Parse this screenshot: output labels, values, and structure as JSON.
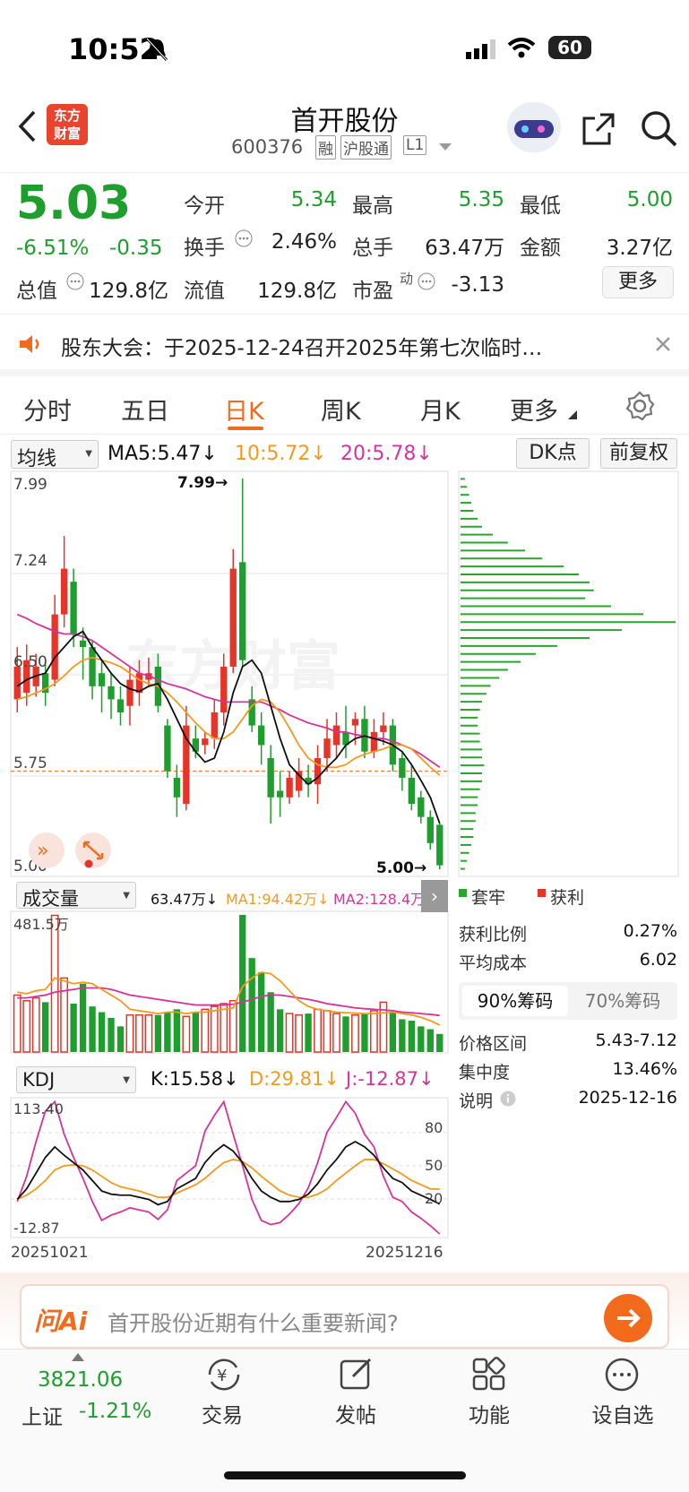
{
  "status_bar": {
    "time": "10:52",
    "battery": "60"
  },
  "header": {
    "title": "首开股份",
    "code": "600376",
    "tags": [
      "融",
      "沪股通",
      "L1"
    ],
    "logo_line1": "东方",
    "logo_line2": "财富"
  },
  "quote": {
    "price": "5.03",
    "change_pct": "-6.51%",
    "change": "-0.35",
    "open_label": "今开",
    "open": "5.34",
    "high_label": "最高",
    "high": "5.35",
    "low_label": "最低",
    "low": "5.00",
    "turnover_label": "换手",
    "turnover": "2.46%",
    "volume_label": "总手",
    "volume": "63.47万",
    "amount_label": "金额",
    "amount": "3.27亿",
    "mcap_label": "总值",
    "mcap": "129.8亿",
    "float_label": "流值",
    "float": "129.8亿",
    "pe_label": "市盈",
    "pe_sup": "动",
    "pe": "-3.13",
    "more_label": "更多"
  },
  "notice": {
    "text": "股东大会：于2025-12-24召开2025年第七次临时…"
  },
  "tabs": [
    "分时",
    "五日",
    "日K",
    "周K",
    "月K",
    "更多"
  ],
  "active_tab": "日K",
  "ma_bar": {
    "selector": "均线",
    "ma5": "MA5:5.47↓",
    "ma10": "10:5.72↓",
    "ma20": "20:5.78↓",
    "dk": "DK点",
    "fq": "前复权"
  },
  "price_axis": {
    "p1": "7.99",
    "p2": "7.24",
    "p3": "6.50",
    "p4": "5.75",
    "p5": "5.00",
    "hi_mark": "7.99→",
    "lo_mark": "5.00→"
  },
  "watermark": "东方财富",
  "vol_bar": {
    "selector": "成交量",
    "v": "63.47万↓",
    "ma1": "MA1:94.42万↓",
    "ma2": "MA2:128.4万",
    "max": "481.5万"
  },
  "kdj_bar": {
    "selector": "KDJ",
    "k": "K:15.58↓",
    "d": "D:29.81↓",
    "j": "J:-12.87↓",
    "max": "113.40",
    "min": "-12.87",
    "l80": "80",
    "l50": "50",
    "l20": "20"
  },
  "dates": {
    "start": "20251021",
    "end": "20251216"
  },
  "chips": {
    "legend_hold": "套牢",
    "legend_profit": "获利",
    "profit_ratio_label": "获利比例",
    "profit_ratio": "0.27%",
    "avg_cost_label": "平均成本",
    "avg_cost": "6.02",
    "tab90": "90%筹码",
    "tab70": "70%筹码",
    "range_label": "价格区间",
    "range": "5.43-7.12",
    "conc_label": "集中度",
    "conc": "13.46%",
    "note_label": "说明",
    "note": "2025-12-16"
  },
  "ai": {
    "logo": "问Ai",
    "placeholder": "首开股份近期有什么重要新闻?"
  },
  "bottom_nav": {
    "index_value": "3821.06",
    "index_name": "上证",
    "index_change": "-1.21%",
    "items": [
      "交易",
      "发帖",
      "功能",
      "设自选"
    ]
  },
  "colors": {
    "up": "#e5352b",
    "down": "#1e9e2c",
    "accent": "#f26a1b",
    "ma10": "#f39a1e",
    "ma20": "#d6339c"
  },
  "chart_data": {
    "type": "candlestick",
    "price_ylim": [
      5.0,
      7.99
    ],
    "candles": [
      {
        "o": 6.3,
        "c": 6.55,
        "h": 6.7,
        "l": 6.2,
        "up": true
      },
      {
        "o": 6.35,
        "c": 6.6,
        "h": 6.72,
        "l": 6.25,
        "up": true
      },
      {
        "o": 6.4,
        "c": 6.55,
        "h": 6.65,
        "l": 6.32,
        "up": true
      },
      {
        "o": 6.5,
        "c": 6.35,
        "h": 6.6,
        "l": 6.25,
        "up": false
      },
      {
        "o": 6.45,
        "c": 6.95,
        "h": 7.1,
        "l": 6.4,
        "up": true
      },
      {
        "o": 6.95,
        "c": 7.3,
        "h": 7.55,
        "l": 6.85,
        "up": true
      },
      {
        "o": 7.2,
        "c": 6.8,
        "h": 7.3,
        "l": 6.7,
        "up": false
      },
      {
        "o": 6.75,
        "c": 6.7,
        "h": 6.85,
        "l": 6.45,
        "up": false
      },
      {
        "o": 6.7,
        "c": 6.4,
        "h": 6.75,
        "l": 6.3,
        "up": false
      },
      {
        "o": 6.5,
        "c": 6.4,
        "h": 6.6,
        "l": 6.2,
        "up": false
      },
      {
        "o": 6.4,
        "c": 6.3,
        "h": 6.5,
        "l": 6.15,
        "up": false
      },
      {
        "o": 6.3,
        "c": 6.2,
        "h": 6.4,
        "l": 6.1,
        "up": false
      },
      {
        "o": 6.25,
        "c": 6.45,
        "h": 6.55,
        "l": 6.1,
        "up": true
      },
      {
        "o": 6.35,
        "c": 6.5,
        "h": 6.6,
        "l": 6.25,
        "up": true
      },
      {
        "o": 6.45,
        "c": 6.5,
        "h": 6.62,
        "l": 6.4,
        "up": true
      },
      {
        "o": 6.55,
        "c": 6.25,
        "h": 6.65,
        "l": 6.2,
        "up": false
      },
      {
        "o": 6.1,
        "c": 5.75,
        "h": 6.15,
        "l": 5.7,
        "up": false
      },
      {
        "o": 5.7,
        "c": 5.55,
        "h": 5.8,
        "l": 5.4,
        "up": false
      },
      {
        "o": 5.5,
        "c": 6.1,
        "h": 6.25,
        "l": 5.45,
        "up": true
      },
      {
        "o": 6.0,
        "c": 5.9,
        "h": 6.1,
        "l": 5.85,
        "up": false
      },
      {
        "o": 5.95,
        "c": 6.0,
        "h": 6.05,
        "l": 5.88,
        "up": true
      },
      {
        "o": 6.0,
        "c": 6.2,
        "h": 6.3,
        "l": 5.92,
        "up": true
      },
      {
        "o": 6.2,
        "c": 6.55,
        "h": 6.65,
        "l": 6.1,
        "up": true
      },
      {
        "o": 6.55,
        "c": 7.3,
        "h": 7.45,
        "l": 6.5,
        "up": true
      },
      {
        "o": 7.35,
        "c": 6.6,
        "h": 7.99,
        "l": 6.55,
        "up": false
      },
      {
        "o": 6.3,
        "c": 6.1,
        "h": 6.4,
        "l": 6.05,
        "up": false
      },
      {
        "o": 6.1,
        "c": 5.95,
        "h": 6.2,
        "l": 5.8,
        "up": false
      },
      {
        "o": 5.85,
        "c": 5.55,
        "h": 5.95,
        "l": 5.35,
        "up": false
      },
      {
        "o": 5.6,
        "c": 5.55,
        "h": 5.75,
        "l": 5.4,
        "up": false
      },
      {
        "o": 5.55,
        "c": 5.7,
        "h": 5.75,
        "l": 5.5,
        "up": true
      },
      {
        "o": 5.6,
        "c": 5.75,
        "h": 5.85,
        "l": 5.55,
        "up": true
      },
      {
        "o": 5.7,
        "c": 5.65,
        "h": 5.8,
        "l": 5.55,
        "up": false
      },
      {
        "o": 5.65,
        "c": 5.85,
        "h": 5.95,
        "l": 5.5,
        "up": true
      },
      {
        "o": 5.85,
        "c": 6.0,
        "h": 6.15,
        "l": 5.75,
        "up": true
      },
      {
        "o": 5.95,
        "c": 6.1,
        "h": 6.2,
        "l": 5.85,
        "up": true
      },
      {
        "o": 6.05,
        "c": 5.95,
        "h": 6.25,
        "l": 5.85,
        "up": false
      },
      {
        "o": 6.1,
        "c": 6.15,
        "h": 6.2,
        "l": 5.95,
        "up": true
      },
      {
        "o": 6.15,
        "c": 5.9,
        "h": 6.25,
        "l": 5.85,
        "up": false
      },
      {
        "o": 5.9,
        "c": 6.05,
        "h": 6.15,
        "l": 5.85,
        "up": true
      },
      {
        "o": 6.05,
        "c": 6.1,
        "h": 6.2,
        "l": 5.95,
        "up": true
      },
      {
        "o": 6.1,
        "c": 5.8,
        "h": 6.15,
        "l": 5.75,
        "up": false
      },
      {
        "o": 5.85,
        "c": 5.7,
        "h": 5.9,
        "l": 5.6,
        "up": false
      },
      {
        "o": 5.7,
        "c": 5.5,
        "h": 5.8,
        "l": 5.45,
        "up": false
      },
      {
        "o": 5.55,
        "c": 5.4,
        "h": 5.6,
        "l": 5.35,
        "up": false
      },
      {
        "o": 5.4,
        "c": 5.2,
        "h": 5.45,
        "l": 5.15,
        "up": false
      },
      {
        "o": 5.34,
        "c": 5.03,
        "h": 5.35,
        "l": 5.0,
        "up": false
      }
    ],
    "ma5": [
      6.4,
      6.45,
      6.48,
      6.5,
      6.62,
      6.7,
      6.78,
      6.82,
      6.7,
      6.6,
      6.5,
      6.42,
      6.38,
      6.36,
      6.4,
      6.42,
      6.3,
      6.15,
      6.0,
      5.9,
      5.82,
      5.85,
      6.05,
      6.35,
      6.55,
      6.6,
      6.5,
      6.25,
      6.0,
      5.8,
      5.72,
      5.65,
      5.7,
      5.78,
      5.85,
      5.95,
      6.0,
      6.02,
      6.0,
      5.98,
      5.95,
      5.9,
      5.8,
      5.68,
      5.55,
      5.35
    ],
    "ma10": [
      6.3,
      6.32,
      6.35,
      6.38,
      6.42,
      6.48,
      6.55,
      6.6,
      6.62,
      6.6,
      6.58,
      6.55,
      6.5,
      6.45,
      6.42,
      6.4,
      6.35,
      6.28,
      6.2,
      6.12,
      6.05,
      6.0,
      6.0,
      6.05,
      6.15,
      6.25,
      6.3,
      6.28,
      6.2,
      6.08,
      5.95,
      5.85,
      5.8,
      5.78,
      5.78,
      5.8,
      5.85,
      5.88,
      5.9,
      5.92,
      5.95,
      5.95,
      5.92,
      5.85,
      5.78,
      5.72
    ],
    "ma20": [
      6.95,
      6.92,
      6.88,
      6.85,
      6.82,
      6.8,
      6.8,
      6.78,
      6.75,
      6.7,
      6.65,
      6.6,
      6.55,
      6.5,
      6.48,
      6.45,
      6.42,
      6.4,
      6.38,
      6.35,
      6.32,
      6.3,
      6.28,
      6.28,
      6.28,
      6.28,
      6.28,
      6.25,
      6.22,
      6.18,
      6.15,
      6.12,
      6.1,
      6.08,
      6.05,
      6.05,
      6.03,
      6.02,
      6.0,
      6.0,
      5.98,
      5.95,
      5.92,
      5.88,
      5.83,
      5.78
    ],
    "volume": [
      200,
      180,
      190,
      175,
      480,
      260,
      170,
      240,
      160,
      140,
      120,
      90,
      130,
      130,
      130,
      130,
      140,
      150,
      125,
      140,
      150,
      160,
      170,
      180,
      481.5,
      330,
      280,
      210,
      150,
      135,
      130,
      135,
      150,
      145,
      135,
      125,
      130,
      135,
      145,
      175,
      140,
      115,
      110,
      90,
      80,
      63.47
    ],
    "vol_ylim": [
      0,
      481.5
    ],
    "vol_ma1": [
      210,
      205,
      215,
      220,
      260,
      250,
      240,
      245,
      240,
      220,
      200,
      180,
      150,
      145,
      140,
      135,
      140,
      140,
      135,
      140,
      140,
      145,
      150,
      155,
      230,
      260,
      280,
      275,
      250,
      215,
      180,
      160,
      150,
      145,
      140,
      138,
      137,
      135,
      135,
      138,
      140,
      135,
      130,
      122,
      110,
      94.42
    ],
    "vol_ma2": [
      190,
      190,
      195,
      200,
      210,
      215,
      220,
      225,
      225,
      225,
      220,
      210,
      200,
      195,
      190,
      185,
      180,
      175,
      170,
      165,
      165,
      165,
      165,
      168,
      175,
      185,
      195,
      200,
      200,
      195,
      190,
      185,
      178,
      170,
      165,
      160,
      155,
      152,
      150,
      148,
      145,
      140,
      138,
      135,
      132,
      128.4
    ],
    "kdj_ylim": [
      -12.87,
      113.4
    ],
    "k": [
      20,
      30,
      45,
      60,
      70,
      62,
      55,
      48,
      38,
      28,
      25,
      24,
      24,
      22,
      20,
      15,
      18,
      30,
      35,
      40,
      55,
      65,
      72,
      66,
      55,
      40,
      28,
      22,
      18,
      18,
      20,
      25,
      35,
      48,
      58,
      70,
      75,
      70,
      62,
      50,
      40,
      36,
      28,
      24,
      20,
      15.58
    ],
    "d": [
      20,
      24,
      30,
      38,
      48,
      52,
      53,
      52,
      48,
      42,
      36,
      32,
      30,
      28,
      25,
      22,
      22,
      26,
      30,
      34,
      40,
      48,
      55,
      58,
      56,
      50,
      42,
      35,
      28,
      24,
      22,
      22,
      25,
      30,
      38,
      45,
      52,
      58,
      58,
      54,
      49,
      44,
      38,
      34,
      30,
      29.81
    ],
    "j": [
      18,
      42,
      75,
      104,
      113,
      82,
      60,
      40,
      18,
      0,
      5,
      8,
      12,
      10,
      8,
      1,
      10,
      38,
      45,
      52,
      85,
      100,
      113,
      82,
      52,
      20,
      0,
      -4,
      -2,
      6,
      16,
      31,
      55,
      84,
      98,
      113,
      102,
      82,
      70,
      42,
      22,
      18,
      8,
      2,
      -5,
      -12.87
    ],
    "chip_profile": [
      0.02,
      0.03,
      0.04,
      0.05,
      0.06,
      0.06,
      0.07,
      0.07,
      0.08,
      0.08,
      0.09,
      0.1,
      0.1,
      0.11,
      0.1,
      0.1,
      0.09,
      0.09,
      0.08,
      0.08,
      0.09,
      0.1,
      0.12,
      0.14,
      0.18,
      0.22,
      0.28,
      0.35,
      0.45,
      0.6,
      0.75,
      1.0,
      0.85,
      0.7,
      0.58,
      0.62,
      0.6,
      0.55,
      0.48,
      0.38,
      0.3,
      0.22,
      0.15,
      0.1,
      0.08,
      0.06,
      0.05,
      0.04,
      0.03,
      0.02
    ],
    "chip_ylim": [
      5.0,
      7.99
    ],
    "cost_line": 5.75
  }
}
